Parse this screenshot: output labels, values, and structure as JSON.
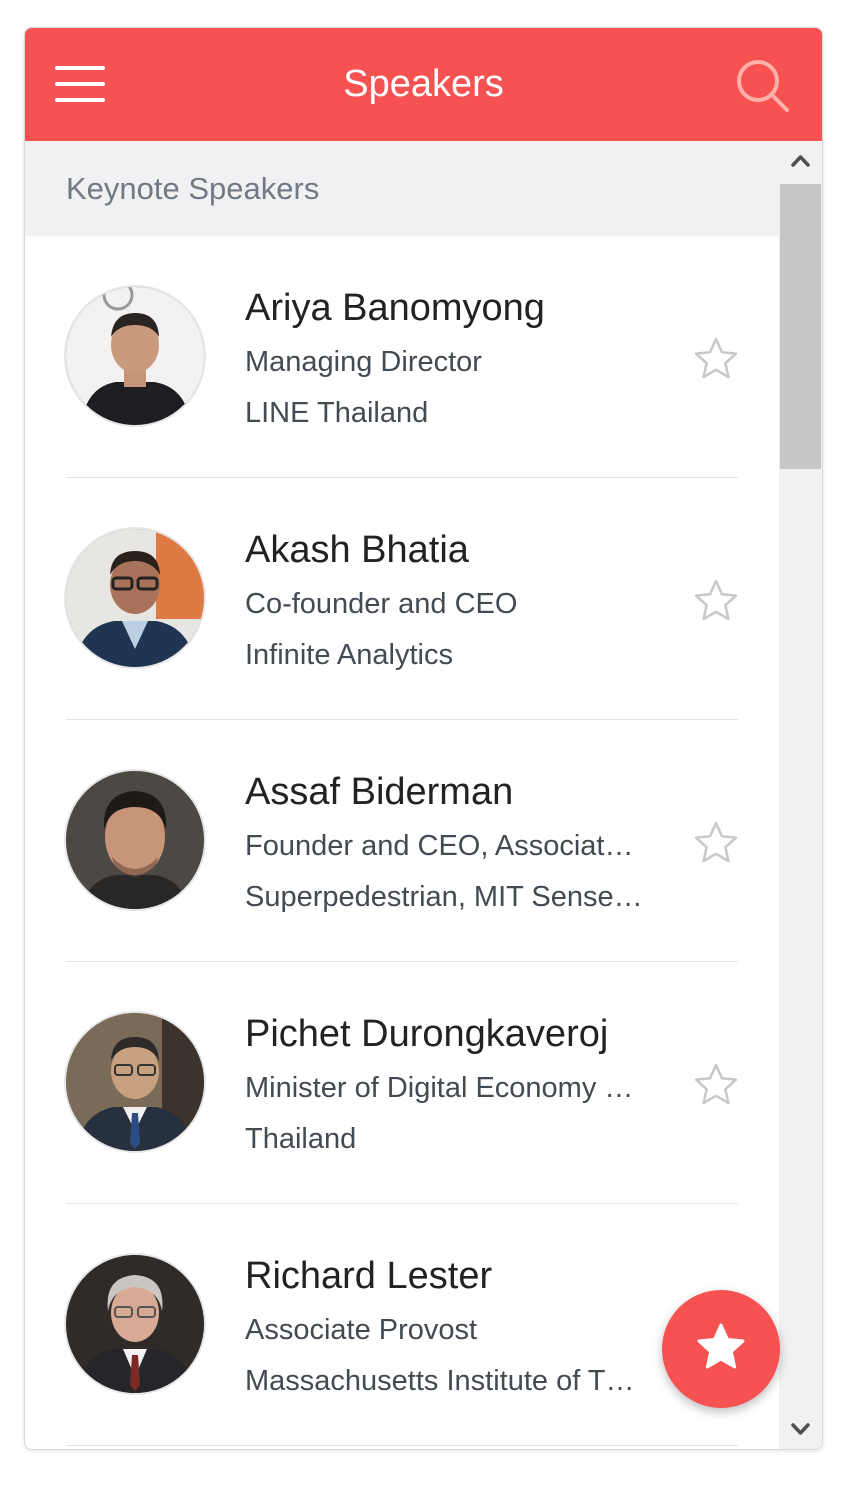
{
  "header": {
    "title": "Speakers",
    "menu_icon": "hamburger-menu-icon",
    "search_icon": "search-icon"
  },
  "section": {
    "title": "Keynote Speakers"
  },
  "speakers": [
    {
      "name": "Ariya Banomyong",
      "role": "Managing Director",
      "org": "LINE Thailand",
      "favorite": false
    },
    {
      "name": "Akash Bhatia",
      "role": "Co-founder and CEO",
      "org": "Infinite Analytics",
      "favorite": false
    },
    {
      "name": "Assaf Biderman",
      "role": "Founder and CEO, Associat…",
      "org": "Superpedestrian, MIT Sense…",
      "favorite": false
    },
    {
      "name": "Pichet Durongkaveroj",
      "role": "Minister of Digital Economy …",
      "org": "Thailand",
      "favorite": false
    },
    {
      "name": "Richard Lester",
      "role": "Associate Provost",
      "org": "Massachusetts Institute of T…",
      "favorite": false
    }
  ],
  "fab": {
    "icon": "star-filled-icon"
  },
  "colors": {
    "accent": "#f75252",
    "section_bg": "#f1f1f3",
    "section_text": "#727a85",
    "star_outline": "#c8c8cc"
  }
}
